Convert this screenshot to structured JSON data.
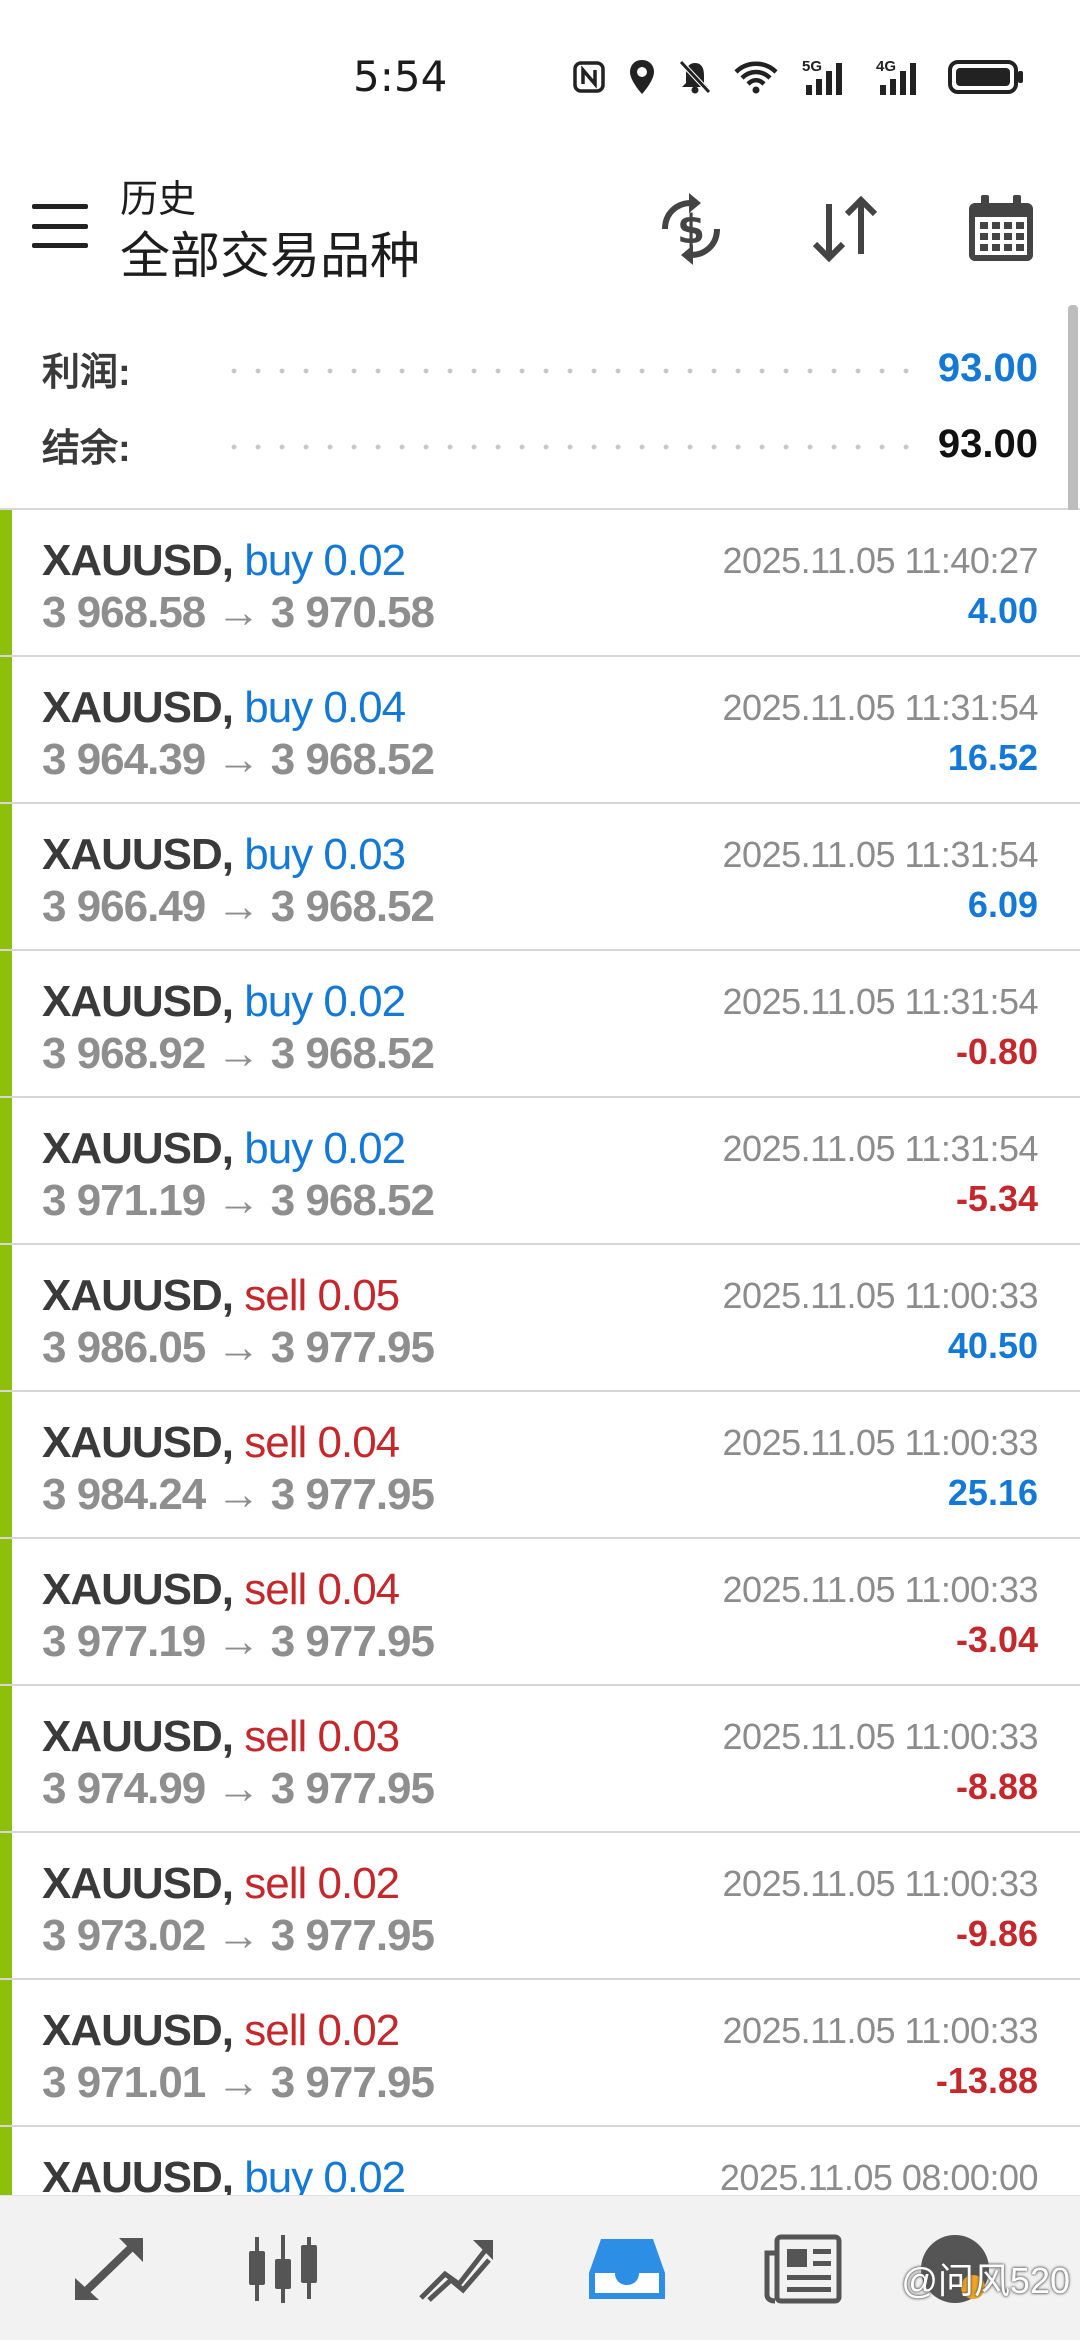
{
  "status_bar": {
    "time": "5:54",
    "icons": [
      "nfc-icon",
      "location-icon",
      "bell-muted-icon",
      "wifi-icon",
      "signal-5g-icon",
      "signal-4g-icon",
      "battery-icon"
    ],
    "network_labels": [
      "5G",
      "4G"
    ]
  },
  "toolbar": {
    "subtitle": "历史",
    "title": "全部交易品种",
    "icons": [
      "menu-icon",
      "currency-exchange-icon",
      "sort-icon",
      "calendar-icon"
    ]
  },
  "summary": {
    "profit_label": "利润:",
    "profit_value": "93.00",
    "balance_label": "结余:",
    "balance_value": "93.00"
  },
  "colors": {
    "buy": "#1479d6",
    "sell": "#c3282c",
    "positive_profit": "#1479d6",
    "negative_profit": "#c3282c",
    "row_accent": "#8cc00a"
  },
  "trades": [
    {
      "symbol": "XAUUSD,",
      "side": "buy 0.02",
      "type": "buy",
      "prices": "3 968.58 → 3 970.58",
      "time": "2025.11.05 11:40:27",
      "profit": "4.00",
      "sign": "pos"
    },
    {
      "symbol": "XAUUSD,",
      "side": "buy 0.04",
      "type": "buy",
      "prices": "3 964.39 → 3 968.52",
      "time": "2025.11.05 11:31:54",
      "profit": "16.52",
      "sign": "pos"
    },
    {
      "symbol": "XAUUSD,",
      "side": "buy 0.03",
      "type": "buy",
      "prices": "3 966.49 → 3 968.52",
      "time": "2025.11.05 11:31:54",
      "profit": "6.09",
      "sign": "pos"
    },
    {
      "symbol": "XAUUSD,",
      "side": "buy 0.02",
      "type": "buy",
      "prices": "3 968.92 → 3 968.52",
      "time": "2025.11.05 11:31:54",
      "profit": "-0.80",
      "sign": "neg"
    },
    {
      "symbol": "XAUUSD,",
      "side": "buy 0.02",
      "type": "buy",
      "prices": "3 971.19 → 3 968.52",
      "time": "2025.11.05 11:31:54",
      "profit": "-5.34",
      "sign": "neg"
    },
    {
      "symbol": "XAUUSD,",
      "side": "sell 0.05",
      "type": "sell",
      "prices": "3 986.05 → 3 977.95",
      "time": "2025.11.05 11:00:33",
      "profit": "40.50",
      "sign": "pos"
    },
    {
      "symbol": "XAUUSD,",
      "side": "sell 0.04",
      "type": "sell",
      "prices": "3 984.24 → 3 977.95",
      "time": "2025.11.05 11:00:33",
      "profit": "25.16",
      "sign": "pos"
    },
    {
      "symbol": "XAUUSD,",
      "side": "sell 0.04",
      "type": "sell",
      "prices": "3 977.19 → 3 977.95",
      "time": "2025.11.05 11:00:33",
      "profit": "-3.04",
      "sign": "neg"
    },
    {
      "symbol": "XAUUSD,",
      "side": "sell 0.03",
      "type": "sell",
      "prices": "3 974.99 → 3 977.95",
      "time": "2025.11.05 11:00:33",
      "profit": "-8.88",
      "sign": "neg"
    },
    {
      "symbol": "XAUUSD,",
      "side": "sell 0.02",
      "type": "sell",
      "prices": "3 973.02 → 3 977.95",
      "time": "2025.11.05 11:00:33",
      "profit": "-9.86",
      "sign": "neg"
    },
    {
      "symbol": "XAUUSD,",
      "side": "sell 0.02",
      "type": "sell",
      "prices": "3 971.01 → 3 977.95",
      "time": "2025.11.05 11:00:33",
      "profit": "-13.88",
      "sign": "neg"
    },
    {
      "symbol": "XAUUSD,",
      "side": "buy 0.02",
      "type": "buy",
      "prices": "",
      "time": "2025.11.05 08:00:00",
      "profit": "",
      "sign": "pos"
    }
  ],
  "bottom_nav": {
    "items": [
      "quotes-icon",
      "chart-icon",
      "trade-icon",
      "history-icon",
      "news-icon"
    ],
    "active": "history-icon"
  },
  "watermark": "@问风520"
}
